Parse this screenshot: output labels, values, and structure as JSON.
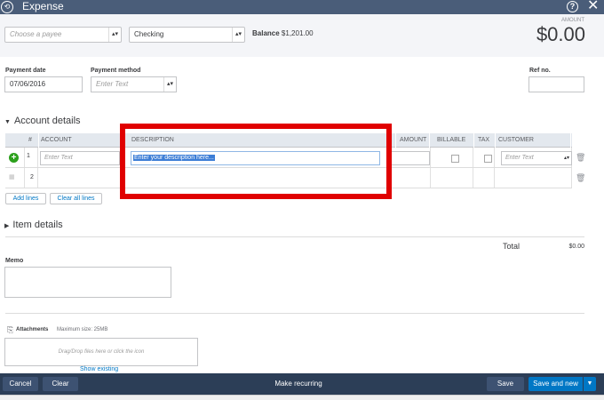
{
  "header": {
    "title": "Expense",
    "history_icon": "clock-history-icon",
    "help_icon": "help-circle-icon",
    "close_icon": "close-icon"
  },
  "top": {
    "payee_placeholder": "Choose a payee",
    "account_value": "Checking",
    "balance_label": "Balance",
    "balance_value": "$1,201.00",
    "amount_label": "AMOUNT",
    "amount_value": "$0.00"
  },
  "payment": {
    "date_label": "Payment date",
    "date_value": "07/06/2016",
    "method_label": "Payment method",
    "method_placeholder": "Enter Text",
    "ref_label": "Ref no."
  },
  "account_details": {
    "title": "Account details",
    "columns": [
      "#",
      "ACCOUNT",
      "DESCRIPTION",
      "AMOUNT",
      "BILLABLE",
      "TAX",
      "CUSTOMER"
    ],
    "rows": [
      {
        "num": "1",
        "account_placeholder": "Enter Text",
        "description_placeholder": "Enter your description here...",
        "customer_placeholder": "Enter Text"
      },
      {
        "num": "2"
      }
    ],
    "add_lines": "Add lines",
    "clear_all_lines": "Clear all lines"
  },
  "item_details": {
    "title": "Item details"
  },
  "totals": {
    "total_label": "Total",
    "total_value": "$0.00"
  },
  "memo": {
    "label": "Memo"
  },
  "attachments": {
    "label": "Attachments",
    "max_size": "Maximum size: 25MB",
    "drop_hint": "Drag/Drop files here or click the icon",
    "show_existing": "Show existing"
  },
  "footer": {
    "cancel": "Cancel",
    "clear": "Clear",
    "make_recurring": "Make recurring",
    "save": "Save",
    "save_and_new": "Save and new"
  },
  "colors": {
    "header_bg": "#4a5d79",
    "footer_bg": "#2c3e57",
    "highlight": "#e00000",
    "primary_button": "#0077c5",
    "add_icon": "#2ca01c"
  }
}
